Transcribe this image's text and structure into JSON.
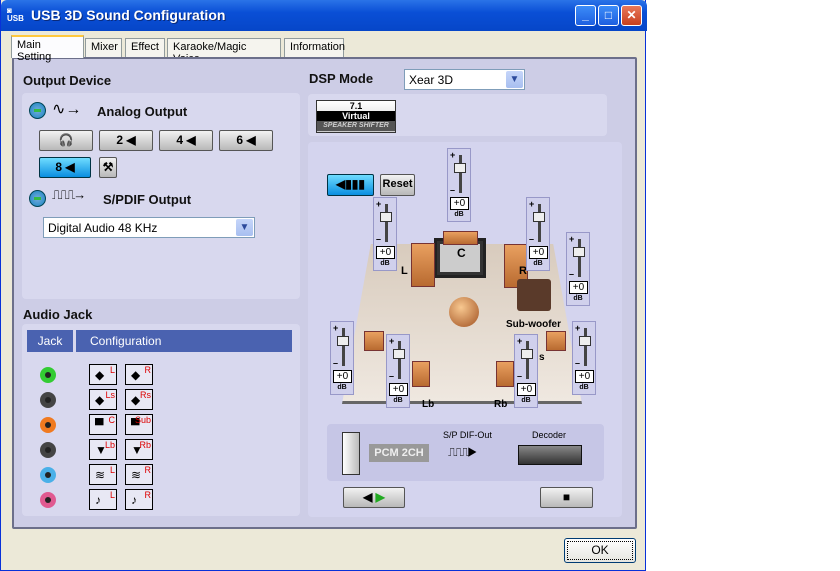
{
  "window": {
    "title": "USB 3D Sound Configuration",
    "controls": [
      "minimize",
      "maximize",
      "close"
    ]
  },
  "tabs": [
    {
      "label": "Main Setting",
      "active": true
    },
    {
      "label": "Mixer"
    },
    {
      "label": "Effect"
    },
    {
      "label": "Karaoke/Magic Voice"
    },
    {
      "label": "Information"
    }
  ],
  "output_device": {
    "title": "Output Device",
    "analog_label": "Analog Output",
    "speaker_buttons": [
      {
        "label": "",
        "icon": "headphones-icon"
      },
      {
        "label": "2"
      },
      {
        "label": "4"
      },
      {
        "label": "6"
      },
      {
        "label": "8",
        "active": true
      }
    ],
    "spdif_label": "S/PDIF Output",
    "spdif_select": "Digital Audio 48 KHz"
  },
  "audio_jack": {
    "title": "Audio Jack",
    "col_jack": "Jack",
    "col_config": "Configuration",
    "rows": [
      {
        "color": "#3c3",
        "left": "L",
        "right": "R"
      },
      {
        "color": "#444",
        "left": "Ls",
        "right": "Rs"
      },
      {
        "color": "#f07a20",
        "left": "C",
        "right": "Sub"
      },
      {
        "color": "#444",
        "left": "Lb",
        "right": "Rb"
      },
      {
        "color": "#4ab0e8",
        "left": "L",
        "right": "R"
      },
      {
        "color": "#e05a90",
        "left": "L",
        "right": "R"
      }
    ]
  },
  "dsp": {
    "title": "DSP Mode",
    "mode": "Xear 3D",
    "shifter": {
      "line1": "7.1",
      "line2": "Virtual",
      "line3": "SPEAKER SHIFTER"
    },
    "reset_label": "Reset",
    "speaker_labels": {
      "c": "C",
      "l": "L",
      "r": "R",
      "sub": "Sub-woofer",
      "s": "s",
      "lb": "Lb",
      "rb": "Rb"
    },
    "sliders": [
      {
        "ch": "C",
        "value": "+0"
      },
      {
        "ch": "L",
        "value": "+0"
      },
      {
        "ch": "R",
        "value": "+0"
      },
      {
        "ch": "Sub",
        "value": "+0"
      },
      {
        "ch": "Ls",
        "value": "+0"
      },
      {
        "ch": "Lb",
        "value": "+0"
      },
      {
        "ch": "Rb",
        "value": "+0"
      },
      {
        "ch": "Rs",
        "value": "+0"
      }
    ],
    "db_unit": "dB",
    "pcm": "PCM 2CH",
    "spdif_out": "S/P DIF-Out",
    "decoder": "Decoder"
  },
  "ok_label": "OK"
}
